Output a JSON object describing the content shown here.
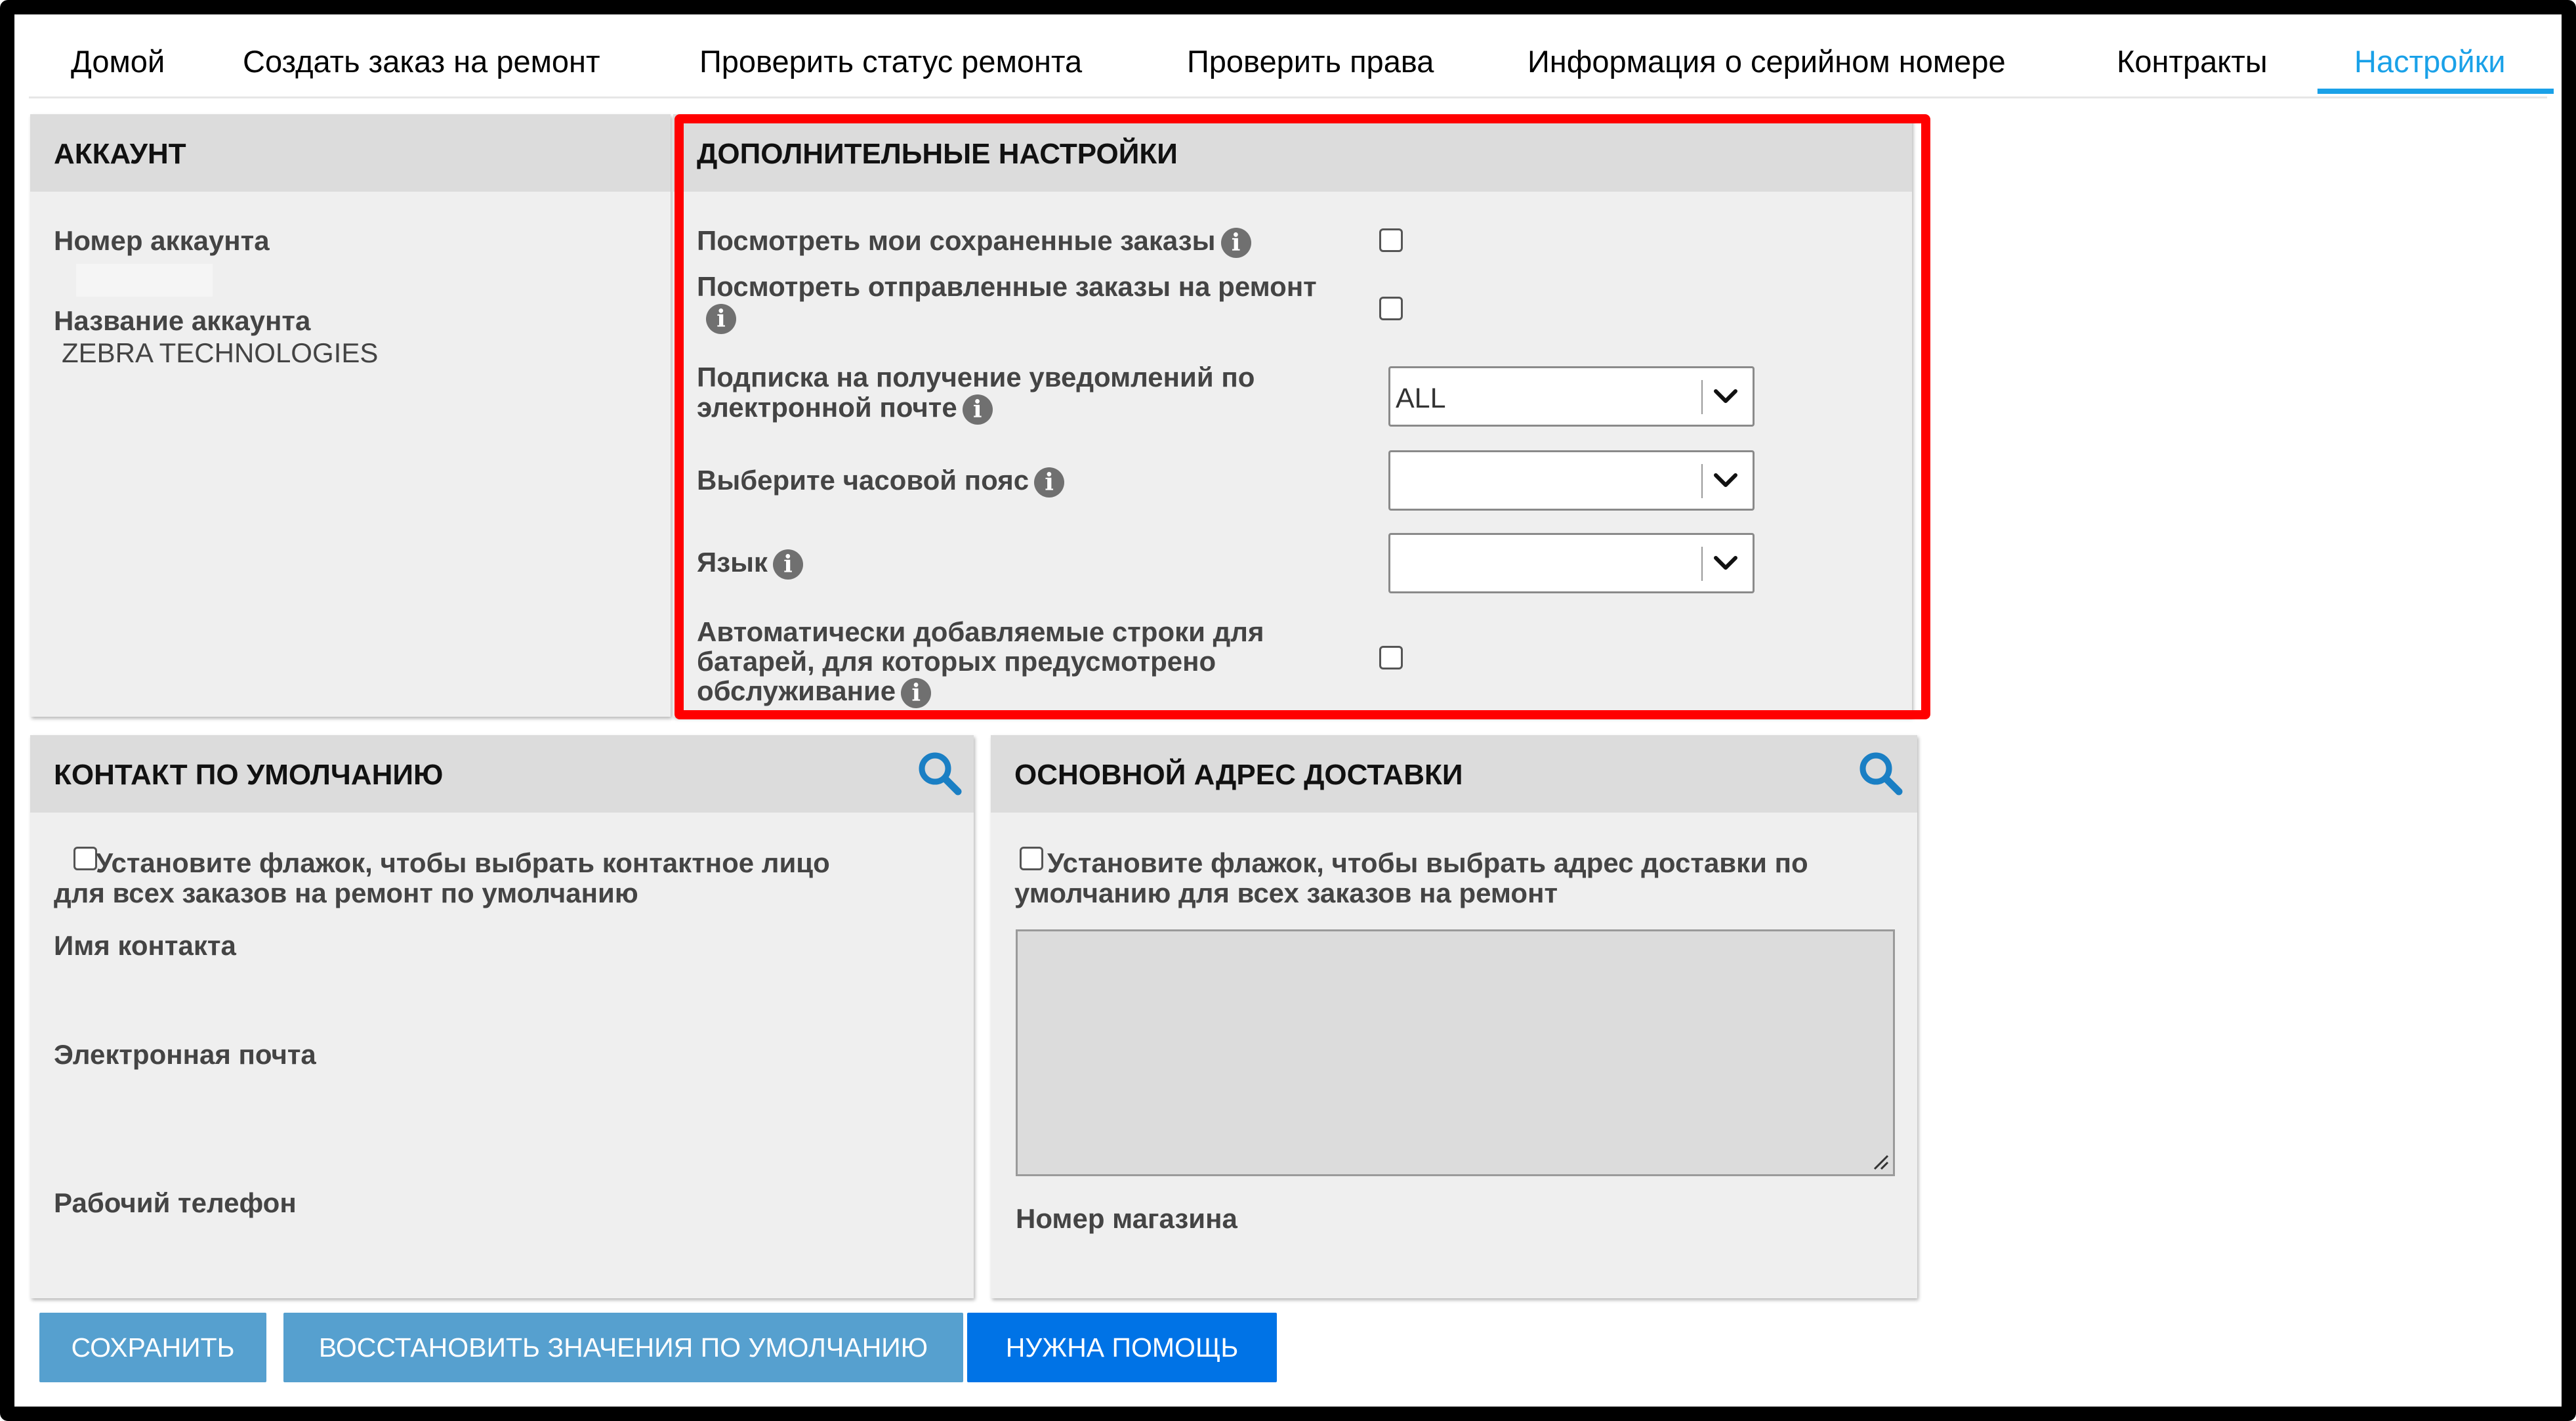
{
  "nav": {
    "items": [
      {
        "label": "Домой"
      },
      {
        "label": "Создать заказ на ремонт"
      },
      {
        "label": "Проверить статус ремонта"
      },
      {
        "label": "Проверить права"
      },
      {
        "label": "Информация о серийном номере"
      },
      {
        "label": "Контракты"
      },
      {
        "label": "Настройки",
        "active": true
      }
    ]
  },
  "account": {
    "title": "АККАУНТ",
    "number_label": "Номер аккаунта",
    "number_value": "",
    "name_label": "Название аккаунта",
    "name_value": "ZEBRA TECHNOLOGIES"
  },
  "additional": {
    "title": "ДОПОЛНИТЕЛЬНЫЕ НАСТРОЙКИ",
    "saved_orders_label": "Посмотреть мои сохраненные заказы",
    "sent_orders_label": "Посмотреть отправленные заказы на ремонт",
    "email_sub_label_1": "Подписка на получение уведомлений по",
    "email_sub_label_2": "электронной почте",
    "email_sub_value": "ALL",
    "timezone_label": "Выберите часовой пояс",
    "timezone_value": "",
    "language_label": "Язык",
    "language_value": "",
    "battery_label_1": "Автоматически добавляемые строки для",
    "battery_label_2": "батарей, для которых предусмотрено",
    "battery_label_3": "обслуживание"
  },
  "contact": {
    "title": "КОНТАКТ ПО УМОЛЧАНИЮ",
    "checkbox_label_1": "Установите флажок, чтобы выбрать контактное лицо",
    "checkbox_label_2": "для всех заказов на ремонт по умолчанию",
    "name_label": "Имя контакта",
    "email_label": "Электронная почта",
    "phone_label": "Рабочий телефон"
  },
  "shipping": {
    "title": "ОСНОВНОЙ АДРЕС ДОСТАВКИ",
    "checkbox_label_1": "Установите флажок, чтобы  выбрать адрес доставки по",
    "checkbox_label_2": "умолчанию для всех заказов на ремонт",
    "address_value": "",
    "store_label": "Номер магазина"
  },
  "buttons": {
    "save": "СОХРАНИТЬ",
    "restore": "ВОССТАНОВИТЬ ЗНАЧЕНИЯ ПО УМОЛЧАНИЮ",
    "help": "НУЖНА ПОМОЩЬ"
  },
  "icons": {
    "info": "info-icon",
    "search": "search-icon",
    "dropdown": "chevron-down-icon"
  },
  "colors": {
    "accent": "#1aa1e8",
    "highlight_border": "#ff0000",
    "button_secondary": "#56a0cf",
    "button_primary": "#0073e6",
    "search_icon": "#1a7fc4"
  }
}
